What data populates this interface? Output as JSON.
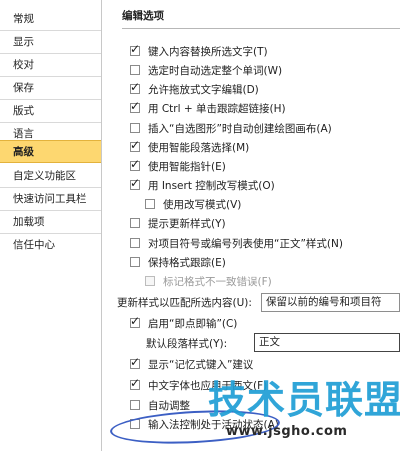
{
  "sidebar": {
    "items": [
      {
        "label": "常规"
      },
      {
        "label": "显示"
      },
      {
        "label": "校对"
      },
      {
        "label": "保存"
      },
      {
        "label": "版式"
      },
      {
        "label": "语言"
      },
      {
        "label": "高级"
      },
      {
        "label": "自定义功能区"
      },
      {
        "label": "快速访问工具栏"
      },
      {
        "label": "加载项"
      },
      {
        "label": "信任中心"
      }
    ],
    "selected": "高级"
  },
  "main": {
    "section_title": "编辑选项",
    "options": [
      {
        "label": "键入内容替换所选文字(T)",
        "checked": true
      },
      {
        "label": "选定时自动选定整个单词(W)",
        "checked": false
      },
      {
        "label": "允许拖放式文字编辑(D)",
        "checked": true
      },
      {
        "label": "用 Ctrl + 单击跟踪超链接(H)",
        "checked": true
      },
      {
        "label": "插入“自选图形”时自动创建绘图画布(A)",
        "checked": false
      },
      {
        "label": "使用智能段落选择(M)",
        "checked": true
      },
      {
        "label": "使用智能指针(E)",
        "checked": true
      },
      {
        "label": "用 Insert 控制改写模式(O)",
        "checked": true
      },
      {
        "label": "使用改写模式(V)",
        "checked": false
      },
      {
        "label": "提示更新样式(Y)",
        "checked": false
      },
      {
        "label": "对项目符号或编号列表使用“正文”样式(N)",
        "checked": false
      },
      {
        "label": "保持格式跟踪(E)",
        "checked": false
      },
      {
        "label": "标记格式不一致错误(F)",
        "checked": false
      },
      {
        "label": "启用“即点即输”(C)",
        "checked": true
      },
      {
        "label": "显示“记忆式键入”建议",
        "checked": true
      },
      {
        "label": "中文字体也应用于西文(F)",
        "checked": true
      },
      {
        "label": "自动调整",
        "checked": false
      },
      {
        "label": "输入法控制处于活动状态(A)",
        "checked": false
      }
    ],
    "update_style_label": "更新样式以匹配所选内容(U):",
    "update_style_value": "保留以前的编号和项目符",
    "default_para_label": "默认段落样式(Y):",
    "default_para_value": "正文"
  },
  "watermark": {
    "text": "技术员联盟",
    "url": "www.jsgho.com"
  },
  "colors": {
    "selected_bg": "#fdd770",
    "watermark": "#1f9ed5",
    "circle": "#3c5fc4"
  }
}
